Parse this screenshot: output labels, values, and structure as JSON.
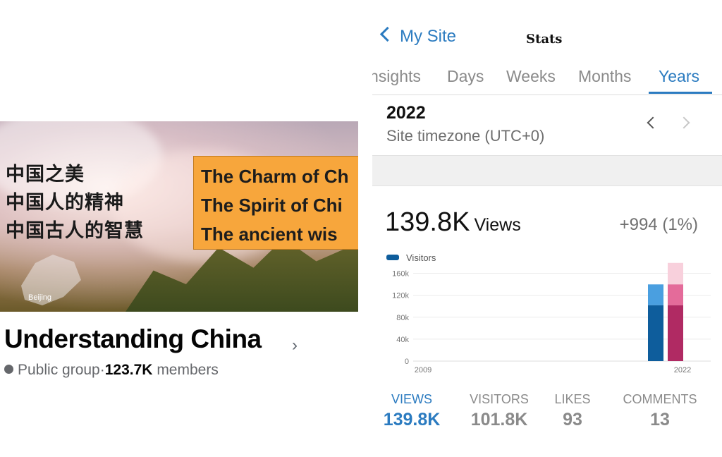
{
  "group": {
    "cover": {
      "cn_lines": [
        "中国之美",
        "中国人的精神",
        "中国古人的智慧"
      ],
      "en_lines": [
        "The Charm of Ch",
        "The Spirit of Chi",
        "The ancient wis"
      ],
      "map_label": "Beijing"
    },
    "name": "Understanding China",
    "privacy": "Public group",
    "separator": "·",
    "members_count": "123.7K",
    "members_label": "members"
  },
  "stats": {
    "back_label": "My Site",
    "title": "Stats",
    "tabs": [
      {
        "label": "Insights",
        "shown": "nsights",
        "active": false
      },
      {
        "label": "Days",
        "active": false
      },
      {
        "label": "Weeks",
        "active": false
      },
      {
        "label": "Months",
        "active": false
      },
      {
        "label": "Years",
        "active": true
      }
    ],
    "period": "2022",
    "timezone": "Site timezone (UTC+0)",
    "views_value": "139.8K",
    "views_unit": "Views",
    "change": "+994 (1%)",
    "legend_label": "Visitors",
    "summary": [
      {
        "label": "VIEWS",
        "value": "139.8K",
        "active": true
      },
      {
        "label": "VISITORS",
        "value": "101.8K",
        "active": false
      },
      {
        "label": "LIKES",
        "value": "93",
        "active": false
      },
      {
        "label": "COMMENTS",
        "value": "13",
        "active": false
      }
    ]
  },
  "chart_data": {
    "type": "bar",
    "categories": [
      "2009",
      "2022"
    ],
    "xlabel": "",
    "ylabel": "",
    "yticks": [
      "0",
      "40k",
      "80k",
      "120k",
      "160k"
    ],
    "ylim": [
      0,
      180000
    ],
    "series": [
      {
        "name": "Views",
        "values": [
          null,
          139800
        ],
        "color": "#4a9fe0"
      },
      {
        "name": "Visitors",
        "values": [
          null,
          101800
        ],
        "color": "#0e5d9c"
      }
    ],
    "highlight_bar": {
      "views": 179000,
      "visitors": 139800,
      "inner": 101800,
      "colors": [
        "#f8d0dc",
        "#e46b9a",
        "#b02a63"
      ]
    },
    "grid": true,
    "legend": "top-left"
  }
}
